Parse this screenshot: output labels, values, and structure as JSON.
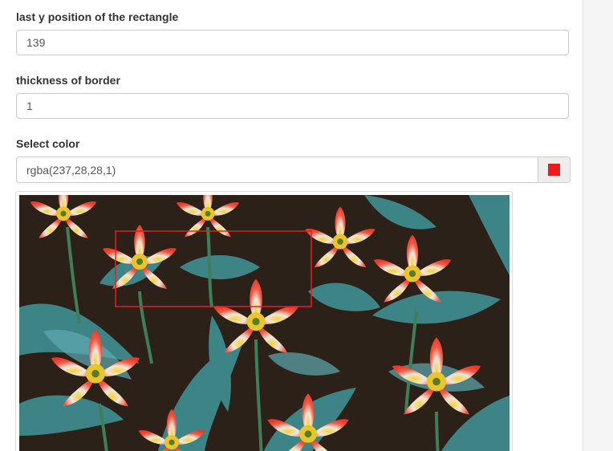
{
  "form": {
    "last_y": {
      "label": "last y position of the rectangle",
      "value": "139"
    },
    "border_thickness": {
      "label": "thickness of border",
      "value": "1"
    },
    "color": {
      "label": "Select color",
      "value": "rgba(237,28,28,1)",
      "swatch_hex": "#ed1c1c"
    }
  },
  "image": {
    "subject": "red and white tulips with blue-green leaves",
    "selection_rectangle_color": "#ed1c1c"
  }
}
